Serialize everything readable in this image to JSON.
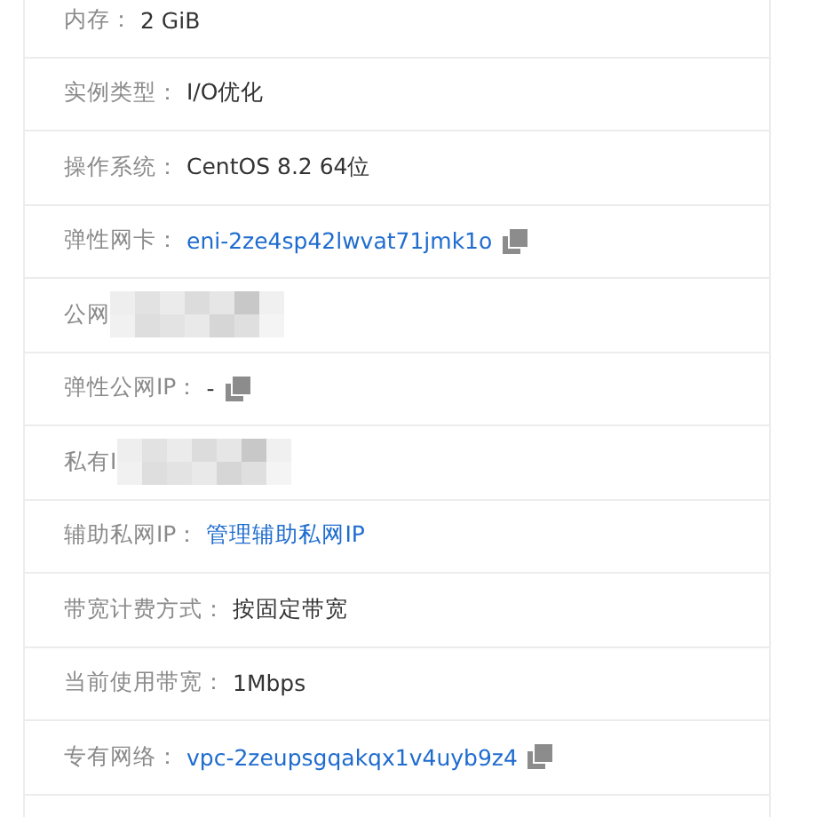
{
  "rows": [
    {
      "label": "内存：",
      "kind": "text",
      "value": "2 GiB"
    },
    {
      "label": "实例类型：",
      "kind": "text",
      "value": "I/O优化"
    },
    {
      "label": "操作系统：",
      "kind": "text",
      "value": "CentOS 8.2 64位"
    },
    {
      "label": "弹性网卡：",
      "kind": "link",
      "value": "eni-2ze4sp42lwvat71jmk1o",
      "copy": true
    },
    {
      "label": "公网",
      "kind": "redacted"
    },
    {
      "label": "弹性公网IP：",
      "kind": "text",
      "value": "-",
      "copy": true
    },
    {
      "label": "私有I",
      "kind": "redacted"
    },
    {
      "label": "辅助私网IP：",
      "kind": "link",
      "value": "管理辅助私网IP"
    },
    {
      "label": "带宽计费方式：",
      "kind": "text",
      "value": "按固定带宽"
    },
    {
      "label": "当前使用带宽：",
      "kind": "text",
      "value": "1Mbps"
    },
    {
      "label": "专有网络：",
      "kind": "link",
      "value": "vpc-2zeupsgqakqx1v4uyb9z4",
      "copy": true
    }
  ]
}
